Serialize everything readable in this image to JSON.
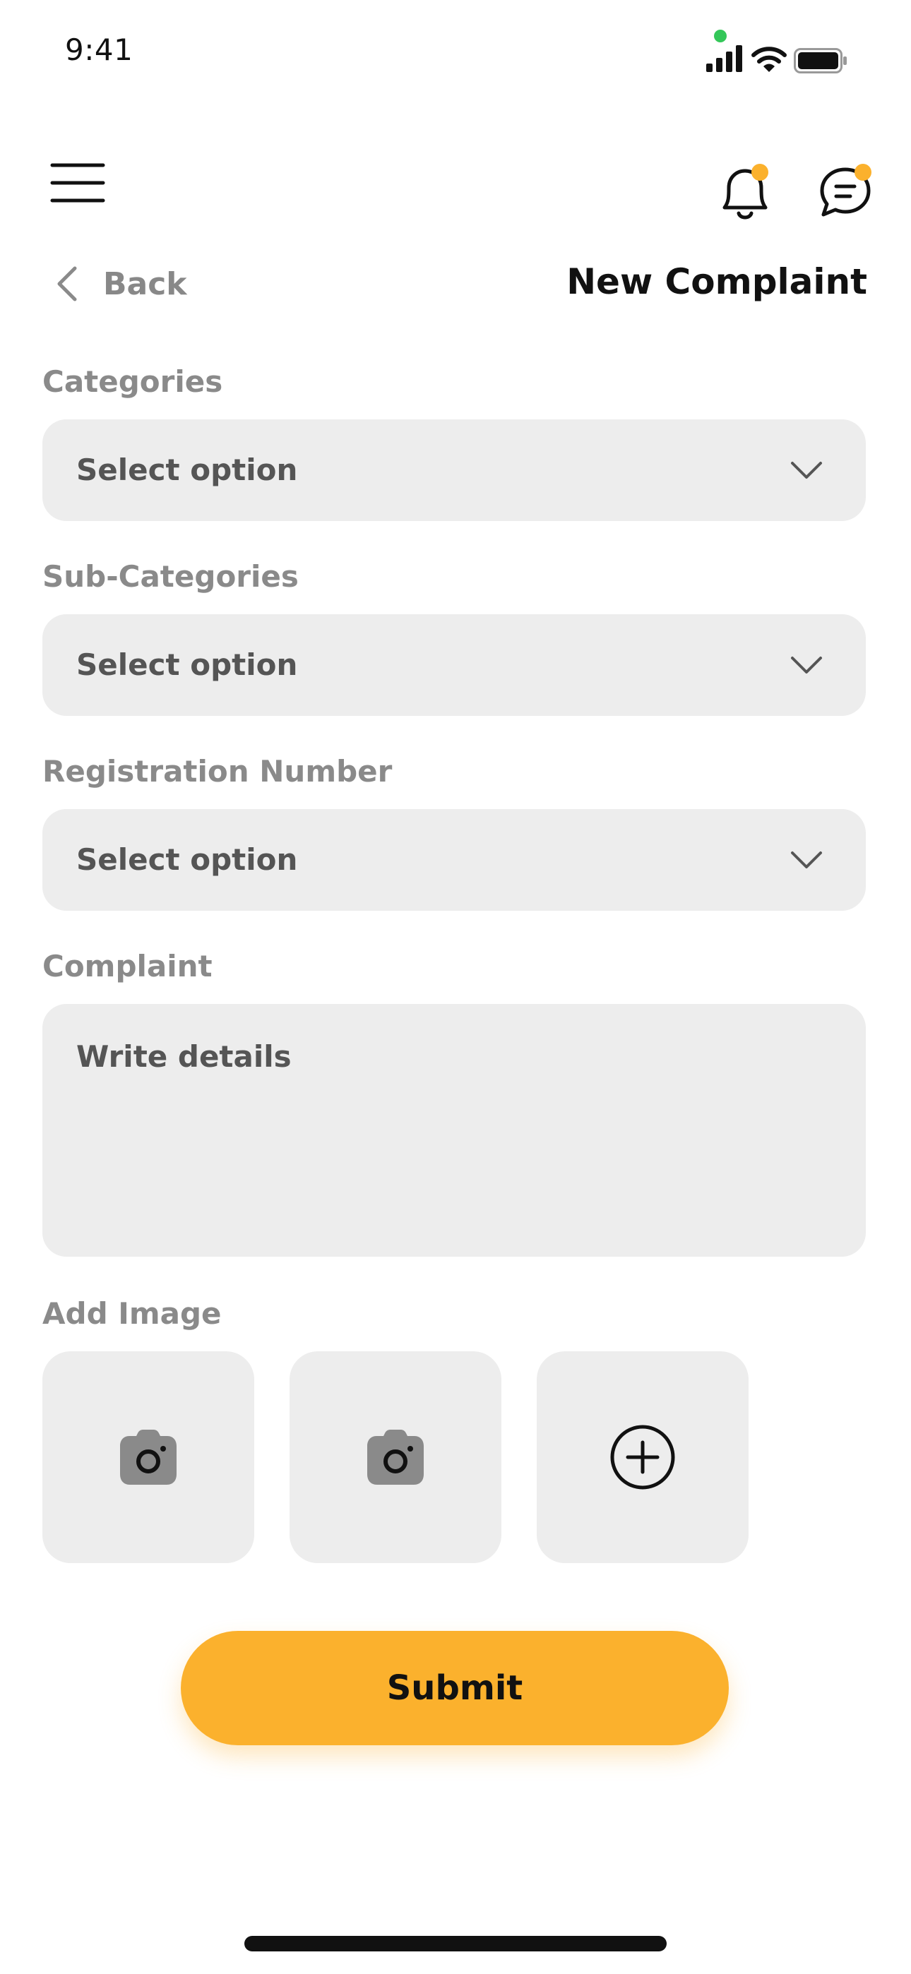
{
  "status_bar": {
    "time": "9:41"
  },
  "header": {
    "menu_icon": "hamburger-icon",
    "notification_icon": "bell-icon",
    "chat_icon": "chat-icon",
    "badge_color": "#FBB12D"
  },
  "nav": {
    "back_label": "Back",
    "title": "New Complaint"
  },
  "form": {
    "categories": {
      "label": "Categories",
      "value": "Select option"
    },
    "sub_categories": {
      "label": "Sub-Categories",
      "value": "Select option"
    },
    "registration_number": {
      "label": "Registration Number",
      "value": "Select option"
    },
    "complaint": {
      "label": "Complaint",
      "placeholder": "Write details"
    },
    "add_image": {
      "label": "Add Image",
      "tiles": [
        "camera-icon",
        "camera-icon",
        "add-circle-icon"
      ]
    },
    "submit_label": "Submit"
  },
  "colors": {
    "accent": "#FBB12D",
    "field_bg": "#EDEDED",
    "label": "#8A8A8A",
    "status_green": "#34C759"
  }
}
